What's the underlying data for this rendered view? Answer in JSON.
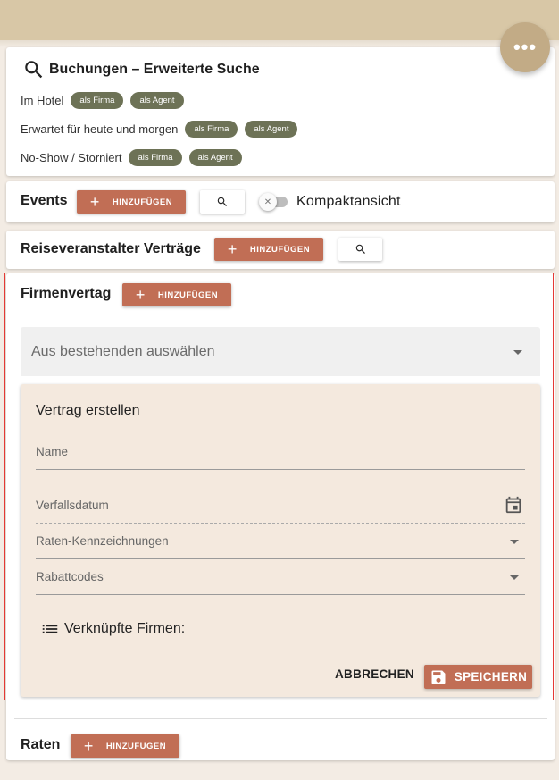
{
  "fab": {
    "label": "•••"
  },
  "search_card": {
    "title": "Buchungen – Erweiterte Suche",
    "rows": [
      {
        "label": "Im Hotel",
        "chips": [
          "als Firma",
          "als Agent"
        ]
      },
      {
        "label": "Erwartet für heute und morgen",
        "chips": [
          "als Firma",
          "als Agent"
        ]
      },
      {
        "label": "No-Show / Storniert",
        "chips": [
          "als Firma",
          "als Agent"
        ]
      }
    ]
  },
  "events": {
    "title": "Events",
    "add_label": "HINZUFÜGEN",
    "toggle_label": "Kompaktansicht",
    "toggle_on": false
  },
  "tour_operator": {
    "title": "Reiseveranstalter Verträge",
    "add_label": "HINZUFÜGEN"
  },
  "company_contract": {
    "title": "Firmenvertag",
    "add_label": "HINZUFÜGEN",
    "select_label": "Aus bestehenden auswählen",
    "form": {
      "title": "Vertrag erstellen",
      "fields": {
        "name": "Name",
        "expiry": "Verfallsdatum",
        "rate_codes": "Raten-Kennzeichnungen",
        "discount_codes": "Rabattcodes"
      },
      "linked_companies": "Verknüpfte Firmen:",
      "cancel_label": "ABBRECHEN",
      "save_label": "SPEICHERN"
    }
  },
  "rates": {
    "title": "Raten",
    "add_label": "HINZUFÜGEN"
  },
  "colors": {
    "accent": "#c16e55",
    "chip": "#6d7256",
    "topbar": "#d8c7a6",
    "highlight": "#e53935"
  }
}
